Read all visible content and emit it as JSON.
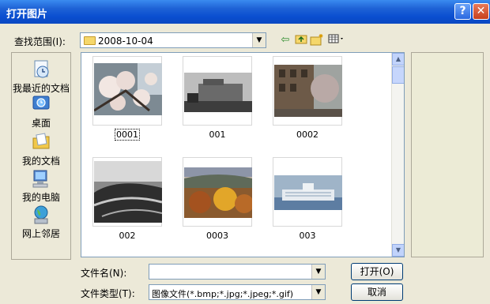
{
  "window": {
    "title": "打开图片",
    "help_glyph": "?",
    "close_glyph": "✕"
  },
  "lookin": {
    "label": "查找范围(I):",
    "value": "2008-10-04"
  },
  "toolbar": {
    "back_icon": "back-arrow-icon",
    "up_icon": "up-folder-icon",
    "newfolder_icon": "new-folder-icon",
    "views_icon": "views-menu-icon"
  },
  "places": [
    {
      "label": "我最近的文档",
      "icon": "recent-documents-icon",
      "color": "#6aa3d8"
    },
    {
      "label": "桌面",
      "icon": "desktop-icon",
      "color": "#3f7fd0"
    },
    {
      "label": "我的文档",
      "icon": "my-documents-icon",
      "color": "#f1c84a"
    },
    {
      "label": "我的电脑",
      "icon": "my-computer-icon",
      "color": "#5d8fd2"
    },
    {
      "label": "网上邻居",
      "icon": "network-places-icon",
      "color": "#3da0d8"
    }
  ],
  "files": [
    {
      "name": "0001",
      "selected": true
    },
    {
      "name": "001",
      "selected": false
    },
    {
      "name": "0002",
      "selected": false
    },
    {
      "name": "002",
      "selected": false
    },
    {
      "name": "0003",
      "selected": false
    },
    {
      "name": "003",
      "selected": false
    }
  ],
  "bottom": {
    "filename_label": "文件名(N):",
    "filename_value": "",
    "filetype_label": "文件类型(T):",
    "filetype_value": "图像文件(*.bmp;*.jpg;*.jpeg;*.gif)",
    "open_label": "打开(O)",
    "cancel_label": "取消"
  }
}
